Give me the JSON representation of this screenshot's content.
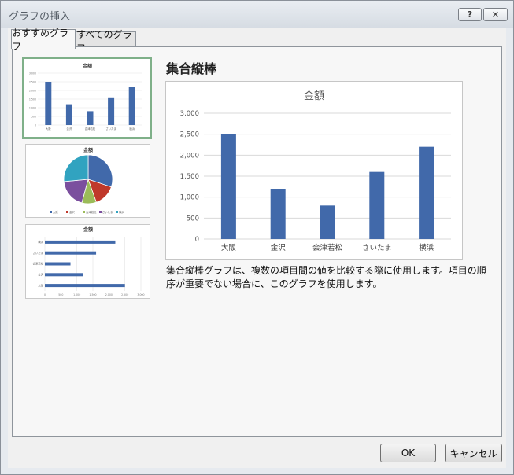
{
  "window": {
    "title": "グラフの挿入",
    "help_label": "?",
    "close_label": "✕"
  },
  "tabs": [
    {
      "label": "おすすめグラフ",
      "active": true
    },
    {
      "label": "すべてのグラフ",
      "active": false
    }
  ],
  "recommended": {
    "heading": "集合縦棒",
    "description": "集合縦棒グラフは、複数の項目間の値を比較する際に使用します。項目の順序が重要でない場合に、このグラフを使用します。"
  },
  "thumbnails": [
    {
      "type": "bar",
      "title": "金額",
      "selected": true
    },
    {
      "type": "pie",
      "title": "金額",
      "selected": false
    },
    {
      "type": "horizontal-bar",
      "title": "金額",
      "selected": false
    }
  ],
  "chart_data": [
    {
      "type": "bar",
      "title": "金額",
      "categories": [
        "大阪",
        "金沢",
        "会津若松",
        "さいたま",
        "横浜"
      ],
      "values": [
        2500,
        1200,
        800,
        1600,
        2200
      ],
      "yticks": [
        "0",
        "500",
        "1,000",
        "1,500",
        "2,000",
        "2,500",
        "3,000"
      ],
      "ylim": [
        0,
        3000
      ],
      "grid": true,
      "color": "#4169aa"
    },
    {
      "type": "pie",
      "title": "金額",
      "categories": [
        "大阪",
        "金沢",
        "会津若松",
        "さいたま",
        "横浜"
      ],
      "values": [
        2500,
        1200,
        800,
        1600,
        2200
      ],
      "colors": [
        "#4169aa",
        "#c0392b",
        "#9bbb59",
        "#7b4f9e",
        "#31a3c0"
      ],
      "legend": "bottom"
    },
    {
      "type": "bar",
      "orientation": "horizontal",
      "title": "金額",
      "categories": [
        "大阪",
        "金沢",
        "会津若松",
        "さいたま",
        "横浜"
      ],
      "values": [
        2500,
        1200,
        800,
        1600,
        2200
      ],
      "xticks": [
        "0",
        "500",
        "1,000",
        "1,500",
        "2,000",
        "2,500",
        "3,000"
      ],
      "xlim": [
        0,
        3000
      ]
    }
  ],
  "buttons": {
    "ok": "OK",
    "cancel": "キャンセル"
  }
}
